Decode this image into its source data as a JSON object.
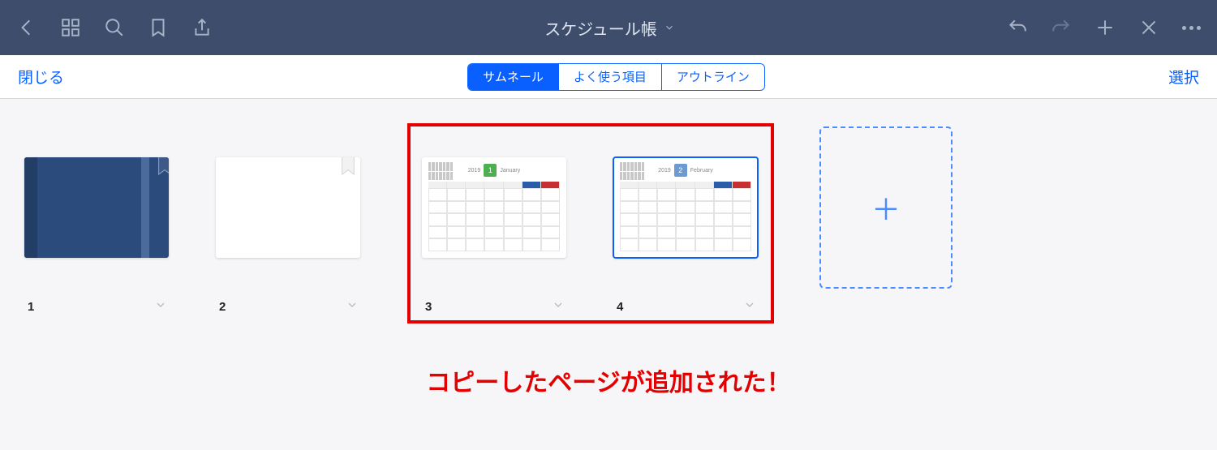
{
  "header": {
    "title": "スケジュール帳"
  },
  "subbar": {
    "close": "閉じる",
    "select": "選択",
    "tabs": [
      "サムネール",
      "よく使う項目",
      "アウトライン"
    ],
    "active_tab": 0
  },
  "pages": {
    "p1": {
      "num": "1"
    },
    "p2": {
      "num": "2"
    },
    "p3": {
      "num": "3",
      "month_num": "1",
      "month_label": "January",
      "year": "2019"
    },
    "p4": {
      "num": "4",
      "month_num": "2",
      "month_label": "February",
      "year": "2019"
    }
  },
  "annotation": "コピーしたページが追加された！"
}
